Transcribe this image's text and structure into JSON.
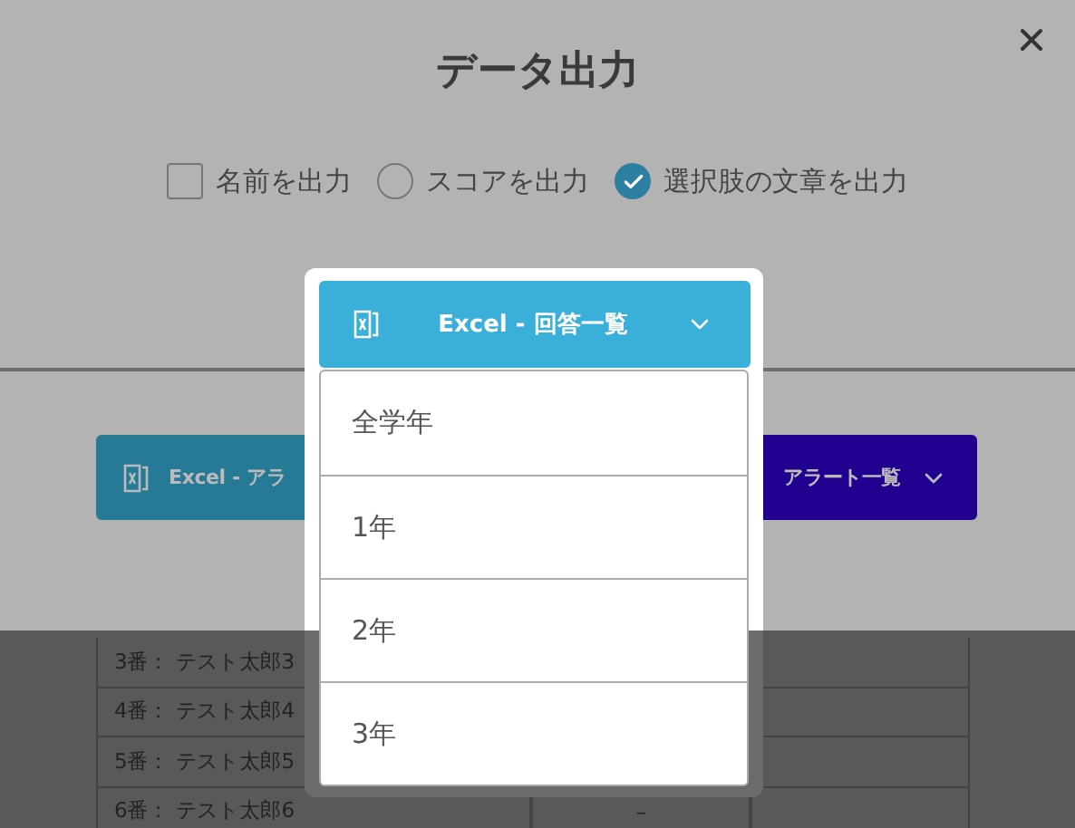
{
  "dialog": {
    "title": "データ出力",
    "options": [
      {
        "label": "名前を出力",
        "kind": "checkbox",
        "checked": false
      },
      {
        "label": "スコアを出力",
        "kind": "radio",
        "checked": false
      },
      {
        "label": "選択肢の文章を出力",
        "kind": "radio",
        "checked": true
      }
    ]
  },
  "export_buttons": [
    {
      "label": "Excel - アラ"
    },
    {
      "label": "アラート一覧"
    }
  ],
  "dropdown": {
    "label": "Excel - 回答一覧",
    "expanded": true,
    "items": [
      {
        "label": "全学年"
      },
      {
        "label": "1年"
      },
      {
        "label": "2年"
      },
      {
        "label": "3年"
      }
    ]
  },
  "table": {
    "rows": [
      {
        "name": "3番： テスト太郎3"
      },
      {
        "name": "4番： テスト太郎4"
      },
      {
        "name": "5番： テスト太郎5"
      },
      {
        "name": "6番： テスト太郎6",
        "column_2": "–"
      }
    ]
  }
}
